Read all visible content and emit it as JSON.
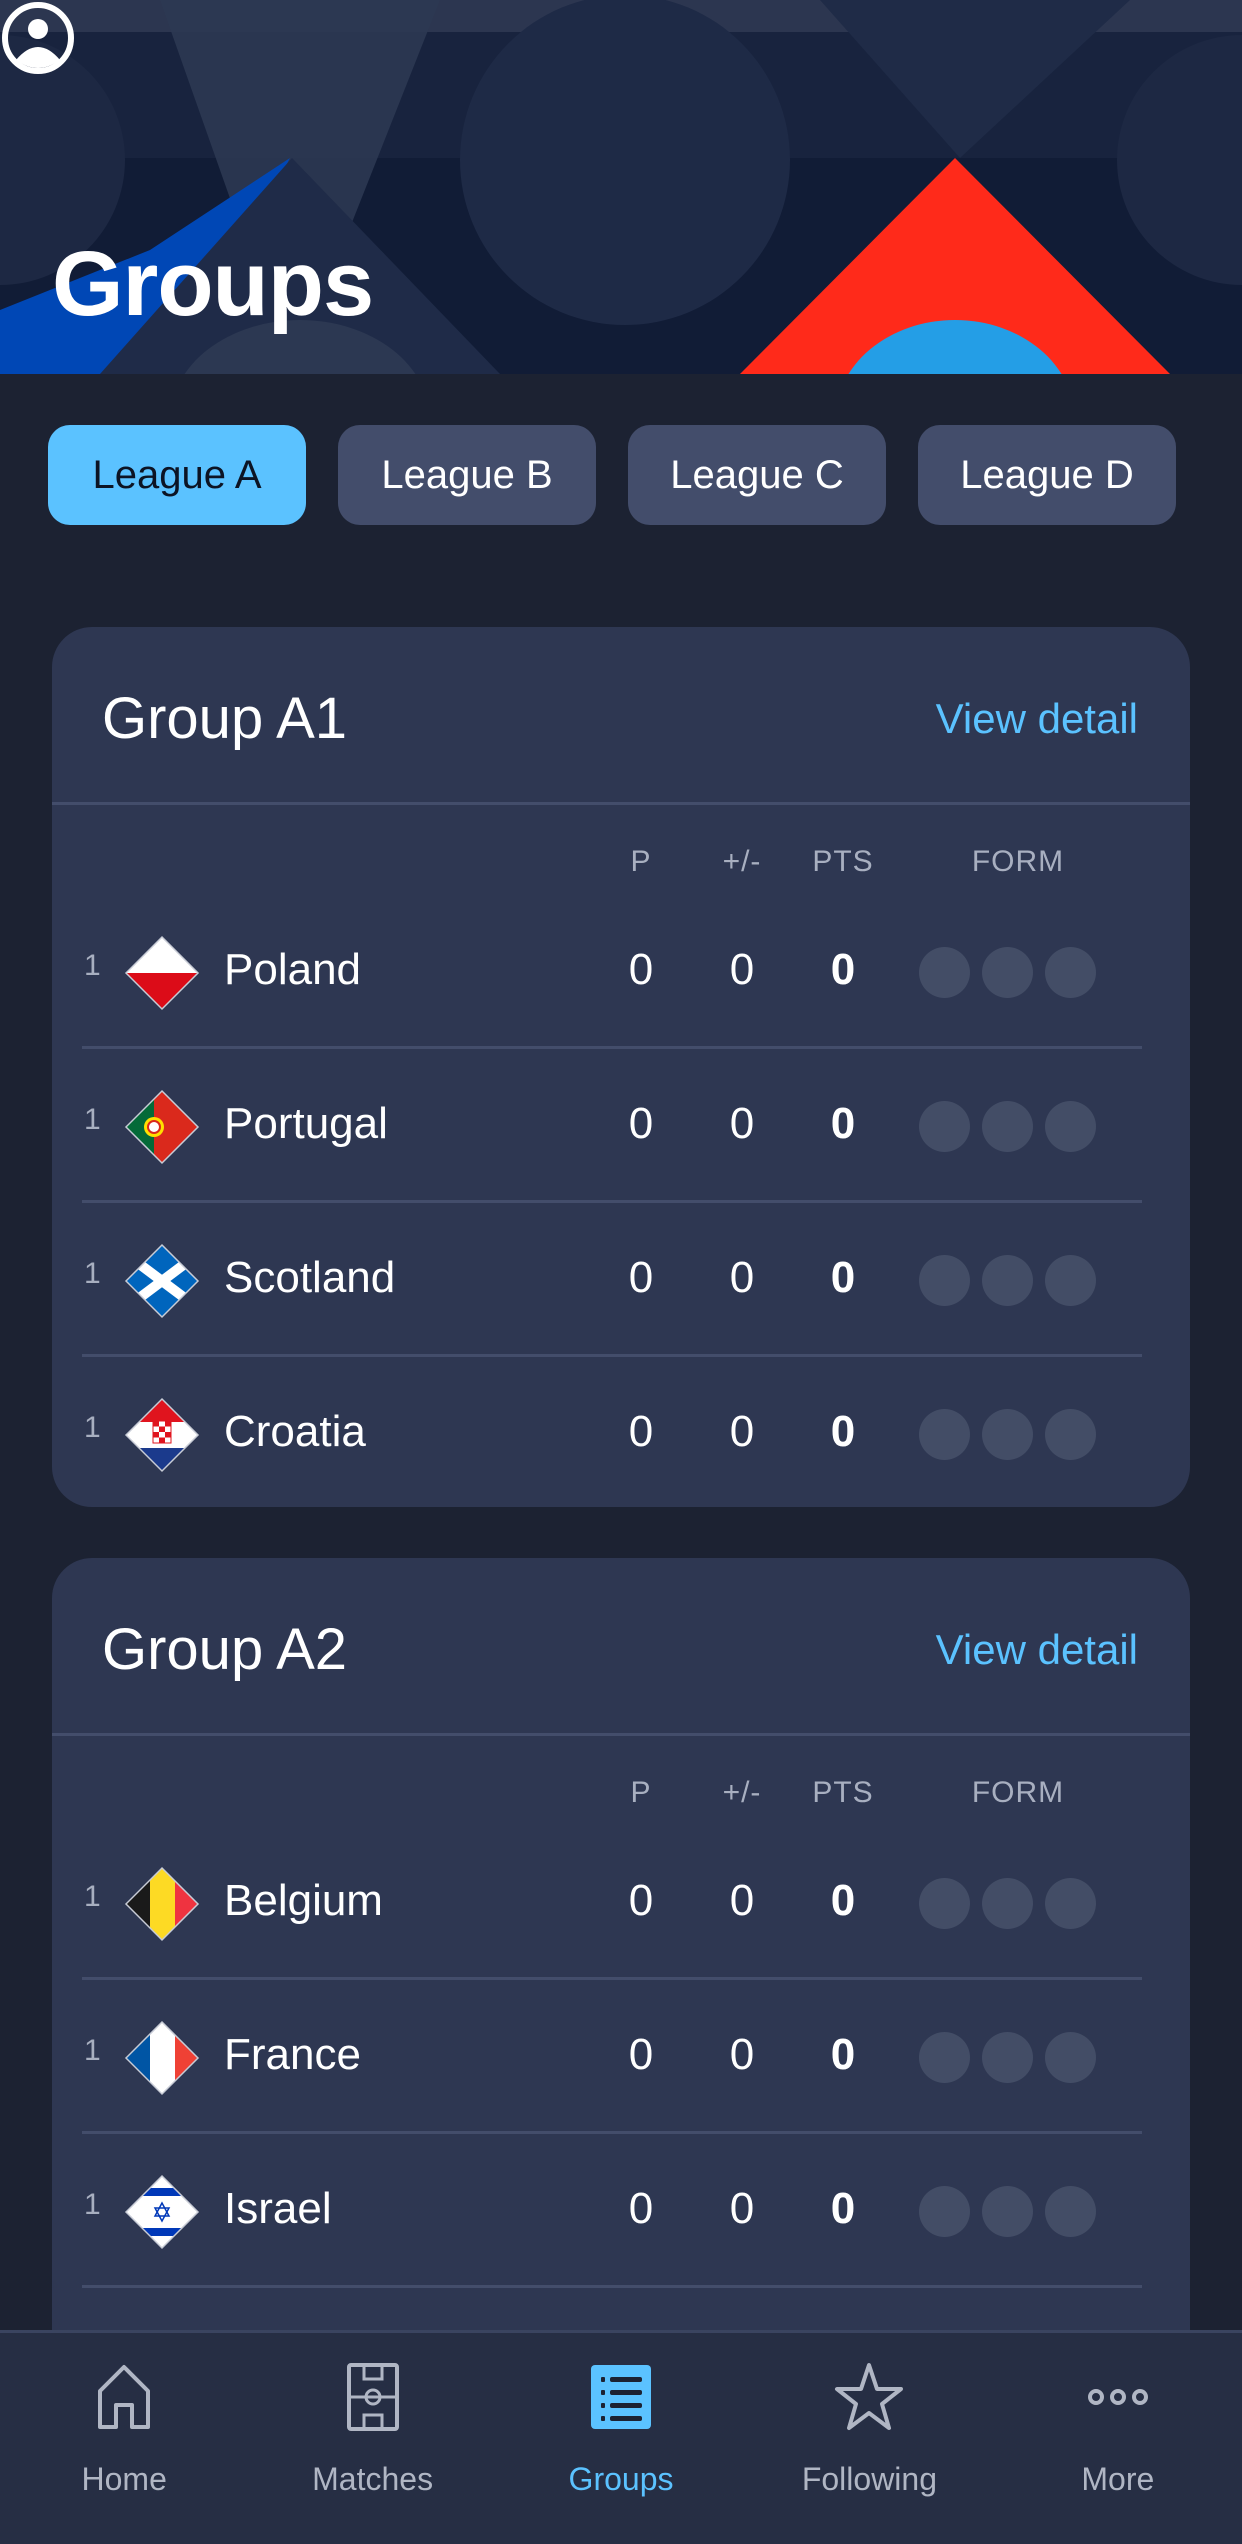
{
  "header": {
    "title": "Groups",
    "profile_icon": "profile-icon"
  },
  "tabs": [
    {
      "label": "League A",
      "active": true
    },
    {
      "label": "League B",
      "active": false
    },
    {
      "label": "League C",
      "active": false
    },
    {
      "label": "League D",
      "active": false
    }
  ],
  "columns": {
    "played": "P",
    "goal_diff": "+/-",
    "points": "PTS",
    "form": "FORM"
  },
  "groups": [
    {
      "title": "Group A1",
      "link": "View detail",
      "rows": [
        {
          "rank": "1",
          "team": "Poland",
          "flag": "poland-flag",
          "p": "0",
          "gd": "0",
          "pts": "0"
        },
        {
          "rank": "1",
          "team": "Portugal",
          "flag": "portugal-flag",
          "p": "0",
          "gd": "0",
          "pts": "0"
        },
        {
          "rank": "1",
          "team": "Scotland",
          "flag": "scotland-flag",
          "p": "0",
          "gd": "0",
          "pts": "0"
        },
        {
          "rank": "1",
          "team": "Croatia",
          "flag": "croatia-flag",
          "p": "0",
          "gd": "0",
          "pts": "0"
        }
      ]
    },
    {
      "title": "Group A2",
      "link": "View detail",
      "rows": [
        {
          "rank": "1",
          "team": "Belgium",
          "flag": "belgium-flag",
          "p": "0",
          "gd": "0",
          "pts": "0"
        },
        {
          "rank": "1",
          "team": "France",
          "flag": "france-flag",
          "p": "0",
          "gd": "0",
          "pts": "0"
        },
        {
          "rank": "1",
          "team": "Israel",
          "flag": "israel-flag",
          "p": "0",
          "gd": "0",
          "pts": "0"
        }
      ]
    }
  ],
  "bottom_nav": [
    {
      "label": "Home",
      "icon": "home-icon",
      "active": false
    },
    {
      "label": "Matches",
      "icon": "pitch-icon",
      "active": false
    },
    {
      "label": "Groups",
      "icon": "list-icon",
      "active": true
    },
    {
      "label": "Following",
      "icon": "star-icon",
      "active": false
    },
    {
      "label": "More",
      "icon": "more-icon",
      "active": false
    }
  ],
  "colors": {
    "accent": "#5bc2ff",
    "card": "#2e3752",
    "background": "#1c2232"
  }
}
